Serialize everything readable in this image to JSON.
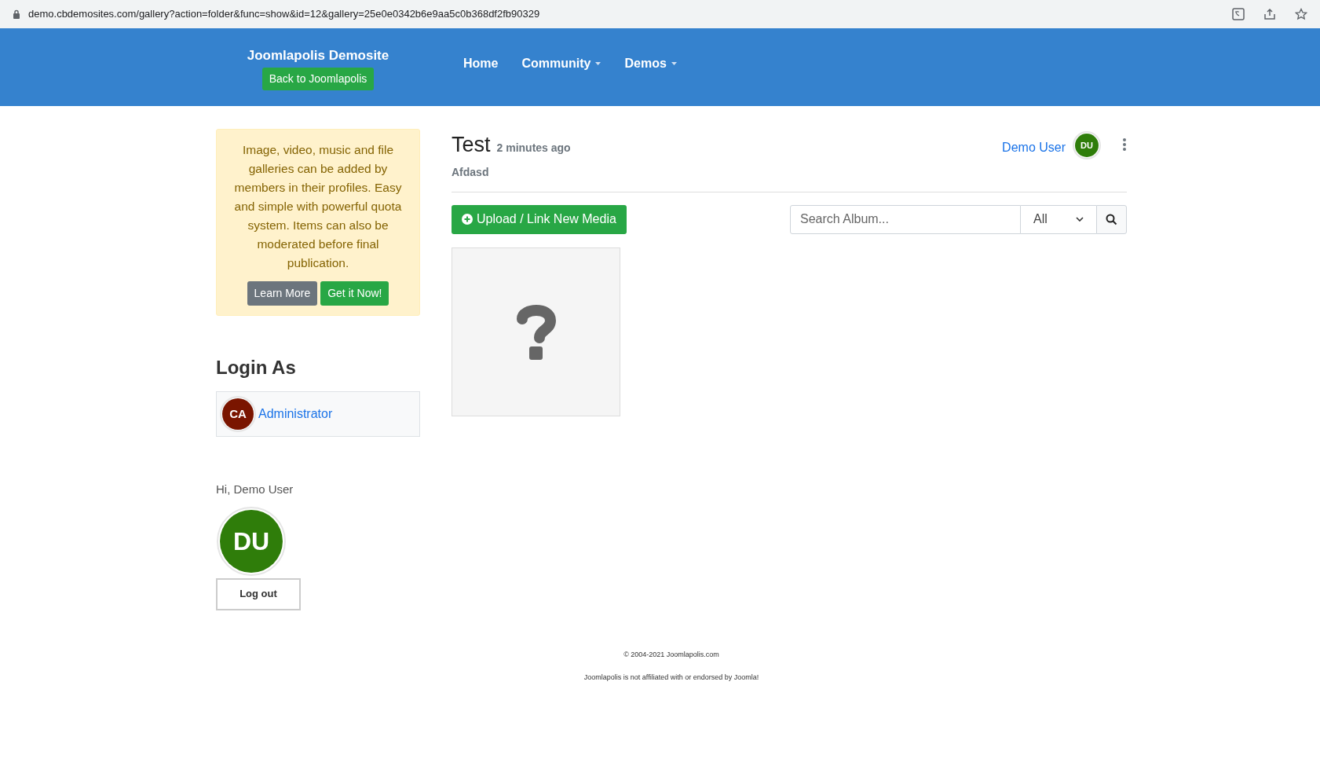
{
  "browser": {
    "url": "demo.cbdemosites.com/gallery?action=folder&func=show&id=12&gallery=25e0e0342b6e9aa5c0b368df2fb90329"
  },
  "header": {
    "site_title": "Joomlapolis Demosite",
    "back_button": "Back to Joomlapolis",
    "nav": [
      {
        "label": "Home",
        "dropdown": false
      },
      {
        "label": "Community",
        "dropdown": true
      },
      {
        "label": "Demos",
        "dropdown": true
      }
    ]
  },
  "promo": {
    "text": "Image, video, music and file galleries can be added by members in their profiles. Easy and simple with powerful quota system. Items can also be moderated before final publication.",
    "buttons": [
      {
        "label": "Learn More",
        "kind": "secondary"
      },
      {
        "label": "Get it Now!",
        "kind": "success"
      }
    ]
  },
  "login_as": {
    "title": "Login As",
    "users": [
      {
        "initials": "CA",
        "name": "Administrator",
        "color": "#7a1500"
      }
    ]
  },
  "greeting": {
    "text": "Hi, Demo User",
    "initials": "DU",
    "logout": "Log out"
  },
  "gallery": {
    "title": "Test",
    "time": "2 minutes ago",
    "description": "Afdasd",
    "owner": "Demo User",
    "owner_initials": "DU",
    "upload_button": "Upload / Link New Media",
    "search": {
      "placeholder": "Search Album..."
    },
    "filter": "All",
    "items": [
      {
        "kind": "unknown"
      }
    ]
  },
  "footer": {
    "lines": [
      "© 2004-2021 Joomlapolis.com",
      "Joomlapolis is not affiliated with or endorsed by Joomla!"
    ]
  }
}
